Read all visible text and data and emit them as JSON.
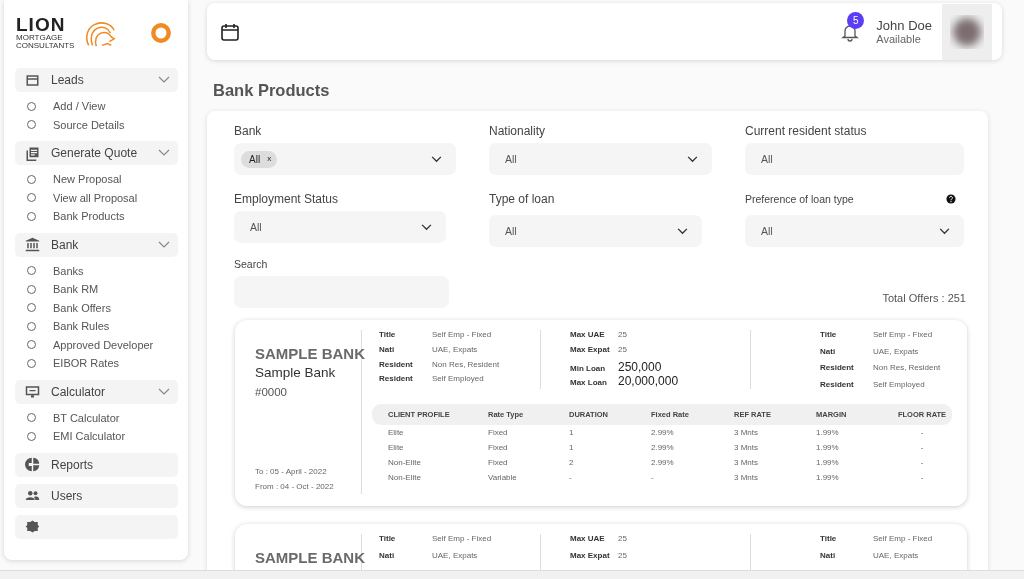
{
  "logo": {
    "name": "LION",
    "tagline": "MORTGAGE CONSULTANTS"
  },
  "sidebar": {
    "sections": [
      {
        "label": "Leads",
        "kind": "card",
        "children": [
          {
            "label": "Add / View",
            "selected": false
          },
          {
            "label": "Source Details",
            "selected": false
          }
        ]
      },
      {
        "label": "Generate Quote",
        "kind": "doc",
        "children": [
          {
            "label": "New Proposal",
            "selected": false
          },
          {
            "label": "View all Proposal",
            "selected": false
          },
          {
            "label": "Bank Products",
            "selected": false
          }
        ]
      },
      {
        "label": "Bank",
        "kind": "bank",
        "children": [
          {
            "label": "Banks",
            "selected": false
          },
          {
            "label": "Bank RM",
            "selected": false
          },
          {
            "label": "Bank Offers",
            "selected": false
          },
          {
            "label": "Bank Rules",
            "selected": false
          },
          {
            "label": "Approved Developer",
            "selected": false
          },
          {
            "label": "EIBOR Rates",
            "selected": false
          }
        ]
      },
      {
        "label": "Calculator",
        "kind": "monitor",
        "children": [
          {
            "label": "BT Calculator",
            "selected": false
          },
          {
            "label": "EMI Calculator",
            "selected": false
          }
        ]
      },
      {
        "label": "Reports",
        "kind": "pie"
      },
      {
        "label": "Users",
        "kind": "users"
      },
      {
        "kind": "gear"
      }
    ]
  },
  "header": {
    "notifications": "5",
    "user": {
      "name": "John Doe",
      "status": "Available"
    }
  },
  "page_title": "Bank Products",
  "filters": [
    {
      "label": "Bank",
      "kind": "chips",
      "chips": [
        "All"
      ],
      "remove": "x"
    },
    {
      "label": "Nationality",
      "kind": "select",
      "value": "All"
    },
    {
      "label": "Current resident status",
      "kind": "text",
      "value": "All"
    },
    {
      "label": "Employment Status",
      "kind": "select",
      "value": "All"
    },
    {
      "label": "Type of loan",
      "kind": "select",
      "value": "All"
    },
    {
      "label": "Preference of loan type",
      "kind": "select",
      "value": "All",
      "help": true
    },
    {
      "label": "Search",
      "kind": "text"
    }
  ],
  "total_offers": "Total Offers : 251",
  "offers": [
    {
      "bank": "SAMPLE BANK",
      "name": "Sample Bank",
      "code": "#0000",
      "to": "To :  05 - April - 2022",
      "from": "From : 04 - Oct - 2022",
      "left": [
        {
          "label": "Title",
          "value": "Self Emp - Fixed"
        },
        {
          "label": "Nati",
          "value": "UAE, Expats"
        },
        {
          "label": "Resident",
          "value": "Non Res, Resident"
        },
        {
          "label": "Resident",
          "value": "Self Employed"
        }
      ],
      "mid": [
        {
          "label": "Max UAE",
          "value": "25",
          "kind": "count"
        },
        {
          "label": "Max Expat",
          "value": "25",
          "kind": "count"
        },
        {
          "label": "Min Loan",
          "value": "250,000",
          "kind": "amount"
        },
        {
          "label": "Max Loan",
          "value": "20,000,000",
          "kind": "amount"
        }
      ],
      "right": [
        {
          "label": "Title",
          "value": "Self Emp - Fixed"
        },
        {
          "label": "Nati",
          "value": "UAE, Expats"
        },
        {
          "label": "Resident",
          "value": "Non Res, Resident"
        },
        {
          "label": "Resident",
          "value": "Self Employed"
        }
      ],
      "table": {
        "columns": [
          "CLIENT PROFILE",
          "Rate Type",
          "DURATION",
          "Fixed Rate",
          "REF RATE",
          "MARGIN",
          "FLOOR RATE"
        ],
        "rows": [
          [
            "Elite",
            "Fixed",
            "1",
            "2.99%",
            "3 Mnts",
            "1.99%",
            "-"
          ],
          [
            "Elite",
            "Fixed",
            "1",
            "2.99%",
            "3 Mnts",
            "1.99%",
            "-"
          ],
          [
            "Non-Elite",
            "Fixed",
            "2",
            "2.99%",
            "3 Mnts",
            "1.99%",
            "-"
          ],
          [
            "Non-Elite",
            "Variable",
            "-",
            "-",
            "3 Mnts",
            "1.99%",
            "-"
          ]
        ]
      }
    },
    {
      "bank": "SAMPLE BANK",
      "left": [
        {
          "label": "Title",
          "value": "Self Emp - Fixed"
        },
        {
          "label": "Nati",
          "value": "UAE, Expats"
        }
      ],
      "mid": [
        {
          "label": "Max UAE",
          "value": "25",
          "kind": "count"
        },
        {
          "label": "Max Expat",
          "value": "25",
          "kind": "count"
        }
      ],
      "right": [
        {
          "label": "Title",
          "value": "Self Emp - Fixed"
        },
        {
          "label": "Nati",
          "value": "UAE, Expats"
        }
      ]
    }
  ]
}
